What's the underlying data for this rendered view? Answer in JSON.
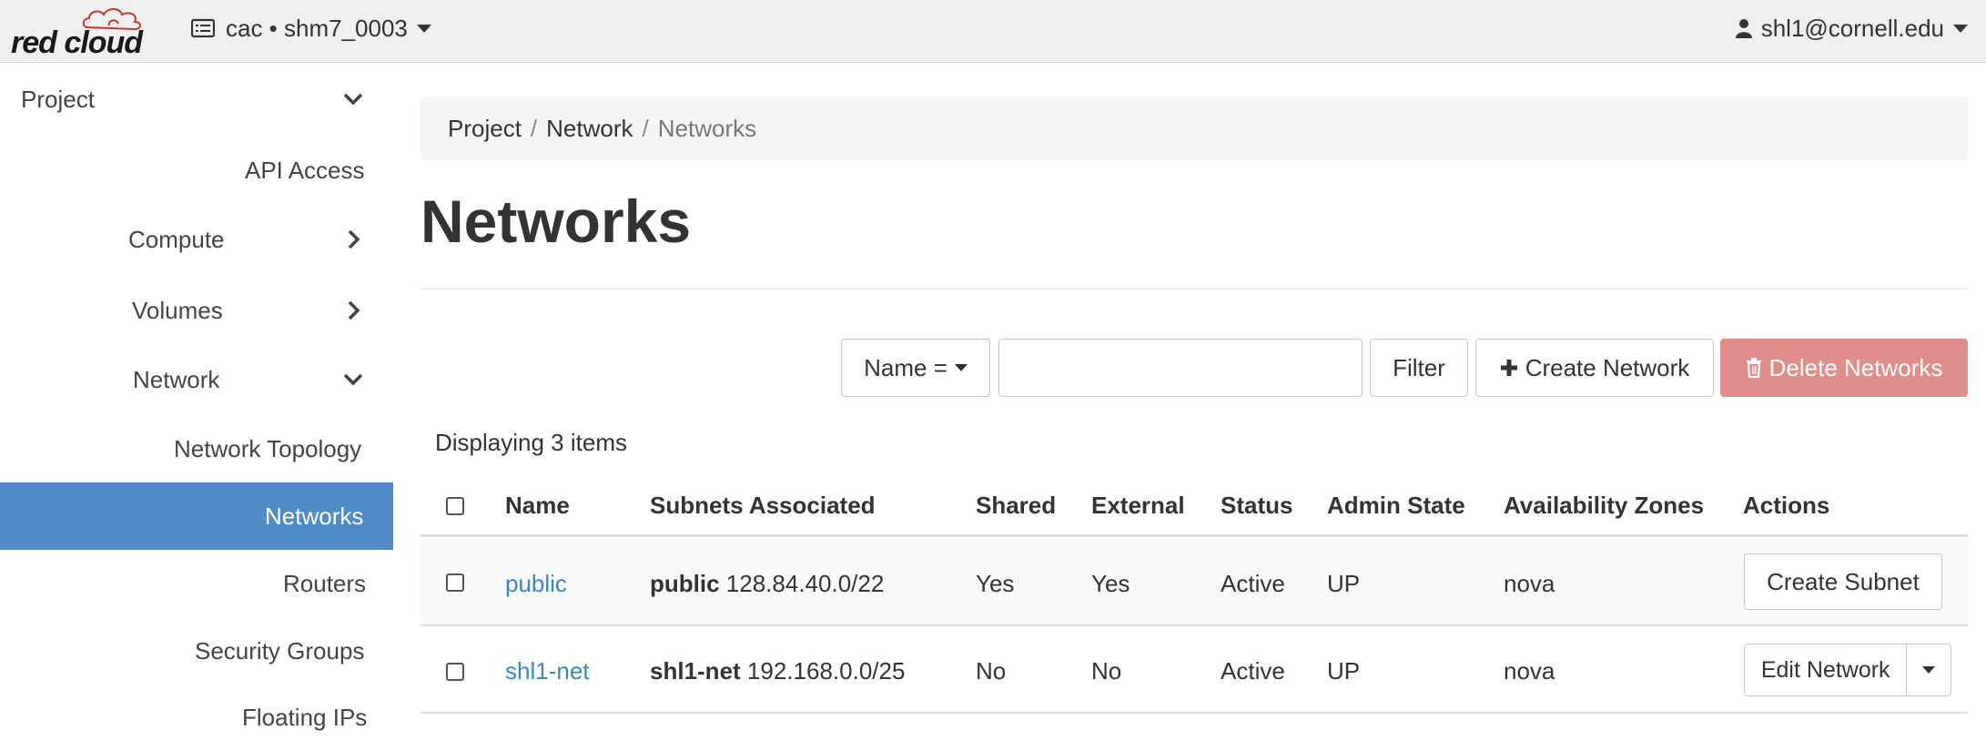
{
  "header": {
    "logo_text": "red cloud",
    "project_selector": "cac • shm7_0003",
    "user": "shl1@cornell.edu"
  },
  "sidebar": {
    "items": [
      {
        "label": "Project",
        "chevron": "down"
      },
      {
        "label": "API Access"
      },
      {
        "label": "Compute",
        "chevron": "right"
      },
      {
        "label": "Volumes",
        "chevron": "right"
      },
      {
        "label": "Network",
        "chevron": "down"
      },
      {
        "label": "Network Topology"
      },
      {
        "label": "Networks",
        "active": true
      },
      {
        "label": "Routers"
      },
      {
        "label": "Security Groups"
      },
      {
        "label": "Floating IPs"
      }
    ]
  },
  "breadcrumb": [
    "Project",
    "Network",
    "Networks"
  ],
  "page_title": "Networks",
  "toolbar": {
    "filter_field": "Name =",
    "filter_value": "",
    "filter_button": "Filter",
    "create_button": "Create Network",
    "delete_button": "Delete Networks"
  },
  "table": {
    "count_text": "Displaying 3 items",
    "columns": [
      "Name",
      "Subnets Associated",
      "Shared",
      "External",
      "Status",
      "Admin State",
      "Availability Zones",
      "Actions"
    ],
    "rows": [
      {
        "name": "public",
        "subnet_name": "public",
        "subnet_cidr": "128.84.40.0/22",
        "shared": "Yes",
        "external": "Yes",
        "status": "Active",
        "admin_state": "UP",
        "zones": "nova",
        "action": "Create Subnet"
      },
      {
        "name": "shl1-net",
        "subnet_name": "shl1-net",
        "subnet_cidr": "192.168.0.0/25",
        "shared": "No",
        "external": "No",
        "status": "Active",
        "admin_state": "UP",
        "zones": "nova",
        "action": "Edit Network"
      }
    ]
  },
  "colors": {
    "active_nav": "#4f8bc9",
    "link": "#3d84c6",
    "danger": "#e08e8b"
  }
}
